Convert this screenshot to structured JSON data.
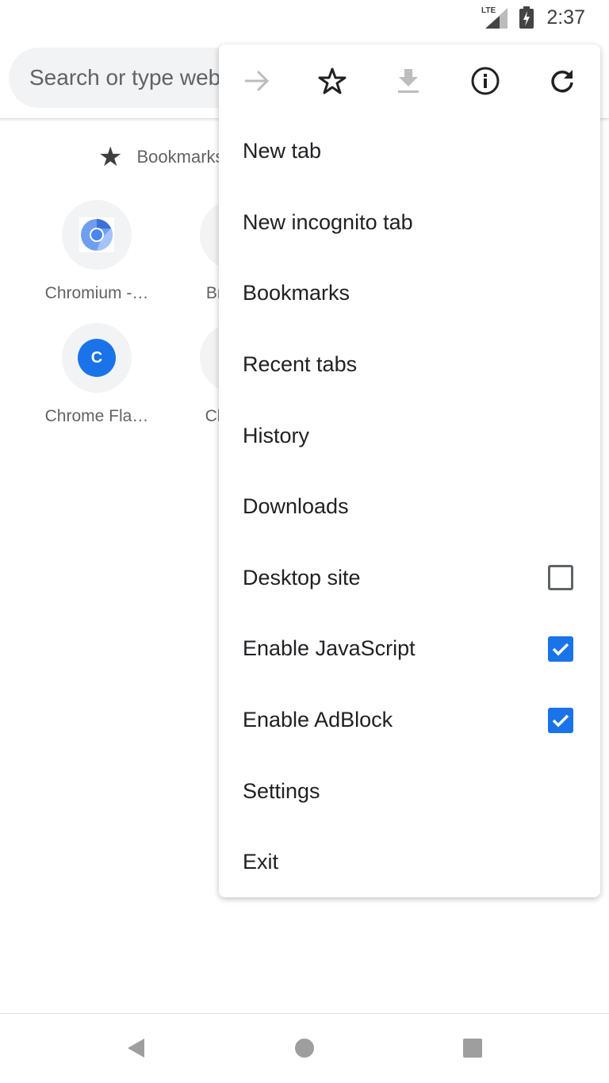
{
  "status_bar": {
    "network": "LTE",
    "time": "2:37",
    "icons": [
      "signal-icon",
      "battery-charging-icon"
    ]
  },
  "omnibox": {
    "placeholder": "Search or type web address"
  },
  "bookmarks": {
    "label": "Bookmarks",
    "icon": "star-filled-icon"
  },
  "tiles": [
    {
      "label": "Chromium -…",
      "icon": "chromium-logo"
    },
    {
      "label": "Bromite",
      "icon": "site-icon"
    },
    {
      "label": "Chrome Fla…",
      "icon": "letter-c",
      "letter": "C"
    },
    {
      "label": "Chrome",
      "icon": "site-icon"
    }
  ],
  "menu": {
    "icons": [
      "forward-icon",
      "bookmark-star-icon",
      "download-icon",
      "info-icon",
      "reload-icon"
    ],
    "items": [
      {
        "label": "New tab"
      },
      {
        "label": "New incognito tab"
      },
      {
        "label": "Bookmarks"
      },
      {
        "label": "Recent tabs"
      },
      {
        "label": "History"
      },
      {
        "label": "Downloads"
      },
      {
        "label": "Desktop site",
        "checked": false
      },
      {
        "label": "Enable JavaScript",
        "checked": true
      },
      {
        "label": "Enable AdBlock",
        "checked": true
      },
      {
        "label": "Settings"
      },
      {
        "label": "Exit"
      }
    ]
  },
  "colors": {
    "accent": "#1a73e8"
  },
  "nav_bar": {
    "icons": [
      "back-icon",
      "home-icon",
      "recents-icon"
    ]
  }
}
